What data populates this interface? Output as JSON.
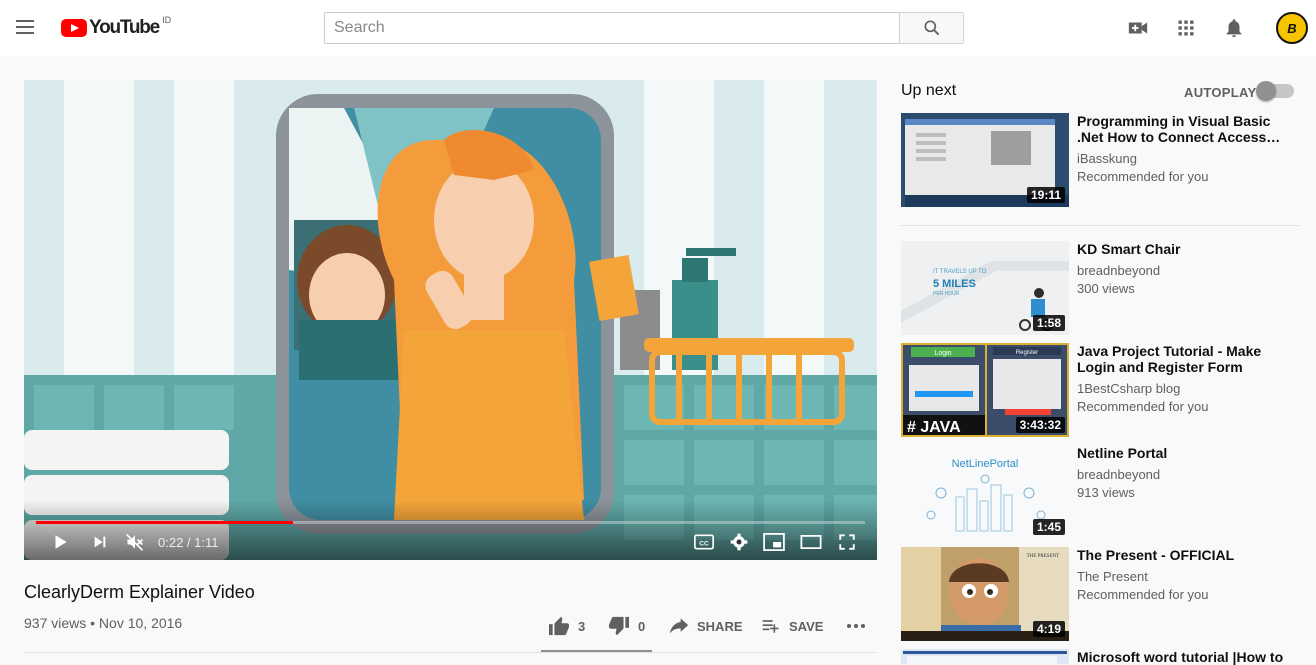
{
  "header": {
    "logo_text": "YouTube",
    "country_code": "ID",
    "search_placeholder": "Search",
    "avatar_letter": "B"
  },
  "player": {
    "time_current": "0:22",
    "time_total": "1:11",
    "time_display": "0:22 / 1:11",
    "progress_fraction": 0.31
  },
  "video": {
    "title": "ClearlyDerm Explainer Video",
    "meta": "937 views • Nov 10, 2016",
    "likes": "3",
    "dislikes": "0",
    "share_label": "SHARE",
    "save_label": "SAVE"
  },
  "sidebar": {
    "up_next_label": "Up next",
    "autoplay_label": "AUTOPLAY",
    "videos": [
      {
        "title": "Programming in Visual Basic .Net How to Connect Access…",
        "channel": "iBasskung",
        "meta": "Recommended for you",
        "duration": "19:11"
      },
      {
        "title": "KD Smart Chair",
        "channel": "breadnbeyond",
        "meta": "300 views",
        "duration": "1:58",
        "thumb_text_1": "IT TRAVELS UP TO",
        "thumb_text_2": "5 MILES",
        "thumb_text_3": "PER HOUR"
      },
      {
        "title": "Java Project Tutorial - Make Login and Register Form Step…",
        "channel": "1BestCsharp blog",
        "meta": "Recommended for you",
        "duration": "3:43:32",
        "thumb_text_1": "Login",
        "thumb_text_2": "Register",
        "thumb_text_3": "# JAVA"
      },
      {
        "title": "Netline Portal",
        "channel": "breadnbeyond",
        "meta": "913 views",
        "duration": "1:45",
        "thumb_text_1": "NetLinePortal"
      },
      {
        "title": "The Present - OFFICIAL",
        "channel": "The Present",
        "meta": "Recommended for you",
        "duration": "4:19",
        "thumb_text_1": "THE PRESENT"
      },
      {
        "title": "Microsoft word tutorial |How to",
        "channel": "",
        "meta": "",
        "duration": ""
      }
    ]
  },
  "colors": {
    "brand_red": "#ff0000",
    "progress_red": "#ff0000",
    "avatar_yellow": "#f7c500",
    "text_secondary": "#606060"
  },
  "icons": [
    "menu-icon",
    "search-icon",
    "video-camera-icon",
    "apps-grid-icon",
    "bell-icon",
    "play-icon",
    "skip-next-icon",
    "volume-muted-icon",
    "captions-icon",
    "settings-icon",
    "miniplayer-icon",
    "theater-icon",
    "fullscreen-icon",
    "thumbs-up-icon",
    "thumbs-down-icon",
    "share-icon",
    "playlist-add-icon",
    "more-icon"
  ]
}
